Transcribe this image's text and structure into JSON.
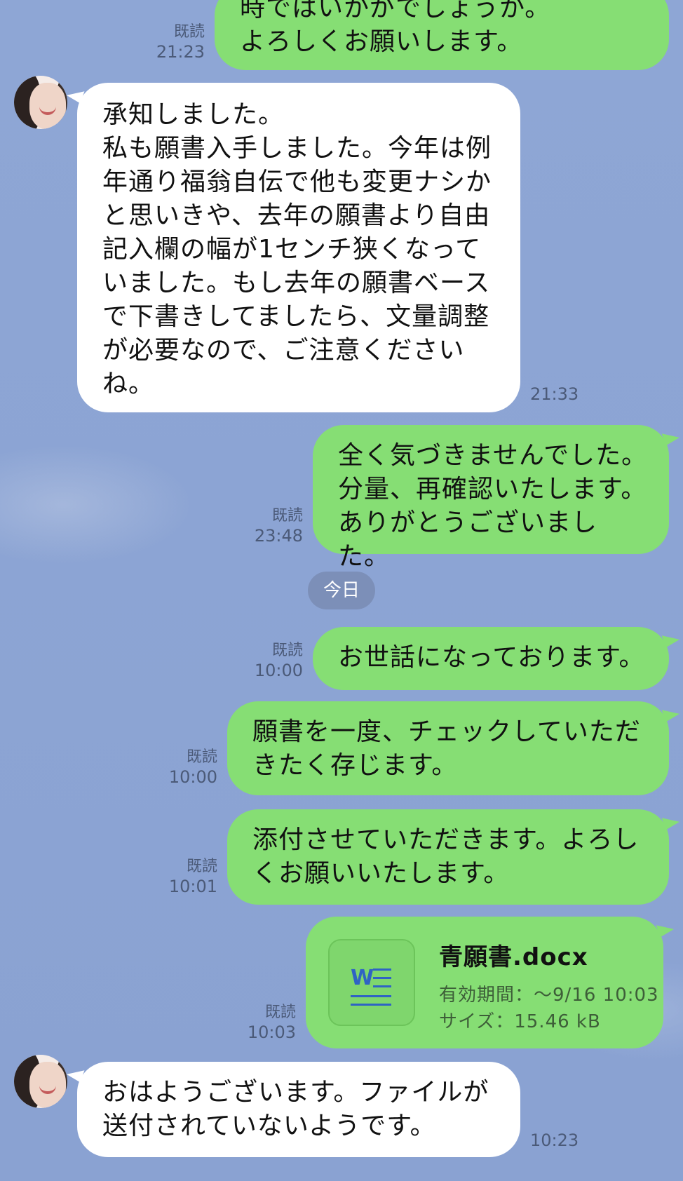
{
  "messages": [
    {
      "side": "right",
      "text": "時ではいかがでしょうか。\nよろしくお願いします。",
      "read": "既読",
      "time": "21:23"
    },
    {
      "side": "left",
      "text": "承知しました。\n私も願書入手しました。今年は例\n年通り福翁自伝で他も変更ナシか\nと思いきや、去年の願書より自由\n記入欄の幅が1センチ狭くなって\nいました。もし去年の願書ベース\nで下書きしてましたら、文量調整\nが必要なので、ご注意ください\nね。",
      "time": "21:33"
    },
    {
      "side": "right",
      "text": "全く気づきませんでした。\n分量、再確認いたします。\nありがとうございました。",
      "read": "既読",
      "time": "23:48"
    },
    {
      "side": "right",
      "text": "お世話になっております。",
      "read": "既読",
      "time": "10:00"
    },
    {
      "side": "right",
      "text": "願書を一度、チェックしていただ\nきたく存じます。",
      "read": "既読",
      "time": "10:00"
    },
    {
      "side": "right",
      "text": "添付させていただきます。よろし\nくお願いいたします。",
      "read": "既読",
      "time": "10:01"
    },
    {
      "side": "left",
      "text": "おはようございます。ファイルが\n送付されていないようです。",
      "time": "10:23"
    }
  ],
  "date_separator": "今日",
  "file": {
    "icon": "word-doc-icon",
    "name": "青願書.docx",
    "expiry": "有効期間：～9/16 10:03",
    "size": "サイズ：15.46 kB",
    "read": "既読",
    "time": "10:03"
  },
  "colors": {
    "background": "#8aa3d3",
    "outgoing": "#86de74",
    "incoming": "#ffffff"
  }
}
